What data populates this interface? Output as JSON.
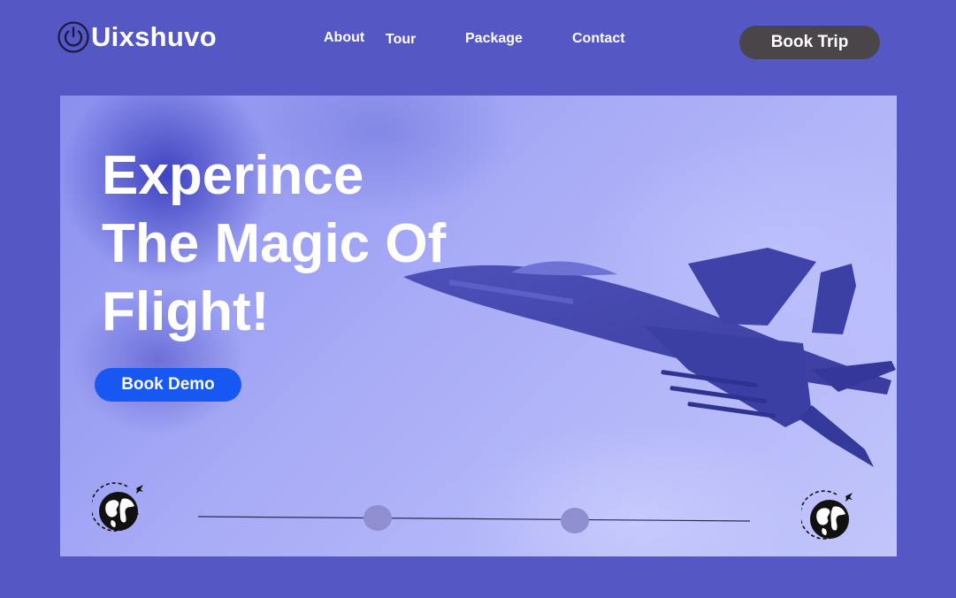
{
  "brand": {
    "name": "Uixshuvo",
    "icon": "power-icon"
  },
  "nav": {
    "links": [
      {
        "label": "About"
      },
      {
        "label": "Tour"
      },
      {
        "label": "Package"
      },
      {
        "label": "Contact"
      }
    ],
    "cta_label": "Book Trip"
  },
  "hero": {
    "title": "Experince\nThe Magic Of\nFlight!",
    "cta_label": "Book Demo",
    "image": "fighter-jet",
    "left_icon": "globe-plane-icon",
    "right_icon": "globe-plane-icon",
    "slider_dots": 2
  },
  "colors": {
    "background": "#5557c5",
    "book_trip_button": "#4a4548",
    "book_demo_button": "#1658f1",
    "slider_dot": "#8f8ed0"
  }
}
